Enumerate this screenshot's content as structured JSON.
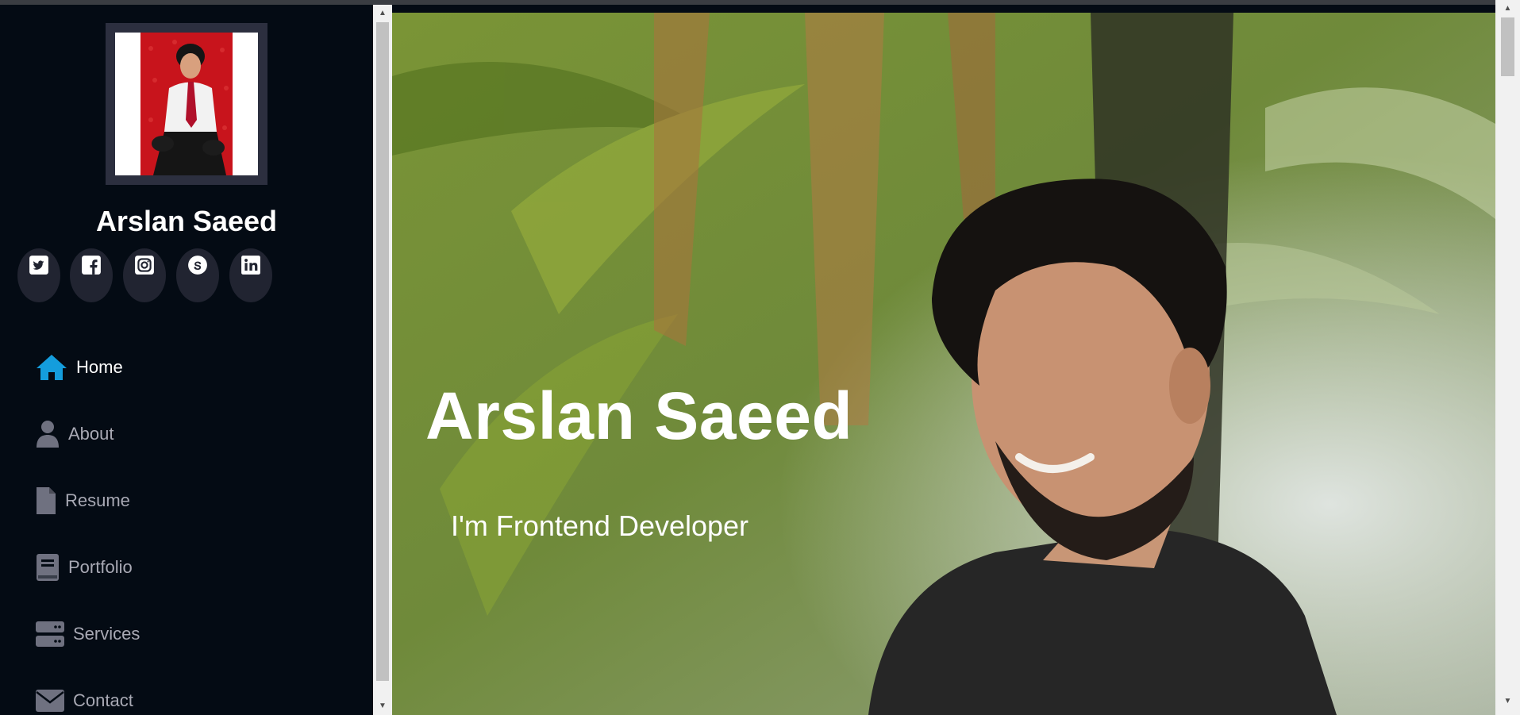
{
  "sidebar": {
    "profile_name": "Arslan Saeed",
    "social": [
      {
        "name": "twitter",
        "icon": "twitter-icon"
      },
      {
        "name": "facebook",
        "icon": "facebook-icon"
      },
      {
        "name": "instagram",
        "icon": "instagram-icon"
      },
      {
        "name": "skype",
        "icon": "skype-icon"
      },
      {
        "name": "linkedin",
        "icon": "linkedin-icon"
      }
    ],
    "nav": [
      {
        "label": "Home",
        "icon": "home-icon",
        "active": true
      },
      {
        "label": "About",
        "icon": "user-icon",
        "active": false
      },
      {
        "label": "Resume",
        "icon": "file-icon",
        "active": false
      },
      {
        "label": "Portfolio",
        "icon": "book-icon",
        "active": false
      },
      {
        "label": "Services",
        "icon": "server-icon",
        "active": false
      },
      {
        "label": "Contact",
        "icon": "envelope-icon",
        "active": false
      }
    ]
  },
  "hero": {
    "title": "Arslan Saeed",
    "subtitle": "I'm Frontend Developer"
  },
  "colors": {
    "sidebar_bg": "#040b14",
    "accent": "#149ddd",
    "nav_text": "#a8a9b4",
    "social_bg": "#212431"
  }
}
